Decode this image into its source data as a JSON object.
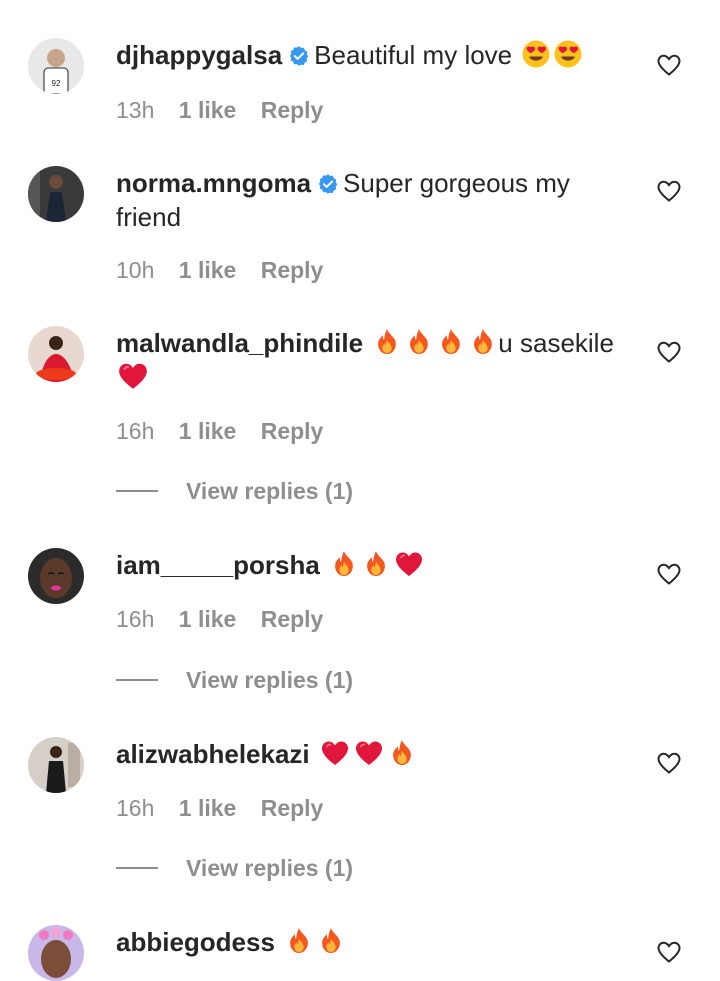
{
  "comments": [
    {
      "username": "djhappygalsa",
      "verified": true,
      "text": "Beautiful my love",
      "emojis": [
        "heart-eyes-emoji",
        "heart-eyes-emoji"
      ],
      "time": "13h",
      "likes": "1 like",
      "reply": "Reply"
    },
    {
      "username": "norma.mngoma",
      "verified": true,
      "text": "Super gorgeous my friend",
      "time": "10h",
      "likes": "1 like",
      "reply": "Reply"
    },
    {
      "username": "malwandla_phindile",
      "verified": false,
      "emojis": [
        "fire-emoji",
        "fire-emoji",
        "fire-emoji",
        "fire-emoji"
      ],
      "text": "u sasekile",
      "emojis_after": [
        "red-heart-emoji"
      ],
      "time": "16h",
      "likes": "1 like",
      "reply": "Reply",
      "view_replies": "View replies (1)"
    },
    {
      "username": "iam_____porsha",
      "verified": false,
      "emojis": [
        "fire-emoji",
        "fire-emoji",
        "red-heart-emoji"
      ],
      "time": "16h",
      "likes": "1 like",
      "reply": "Reply",
      "view_replies": "View replies (1)"
    },
    {
      "username": "alizwabhelekazi",
      "verified": false,
      "emojis": [
        "red-heart-emoji",
        "red-heart-emoji",
        "fire-emoji"
      ],
      "time": "16h",
      "likes": "1 like",
      "reply": "Reply",
      "view_replies": "View replies (1)"
    },
    {
      "username": "abbiegodess",
      "verified": false,
      "emojis": [
        "fire-emoji",
        "fire-emoji"
      ]
    }
  ],
  "colors": {
    "text": "#262626",
    "secondary": "#8e8e8e",
    "verified": "#3897f0",
    "heart_outline": "#262626"
  }
}
